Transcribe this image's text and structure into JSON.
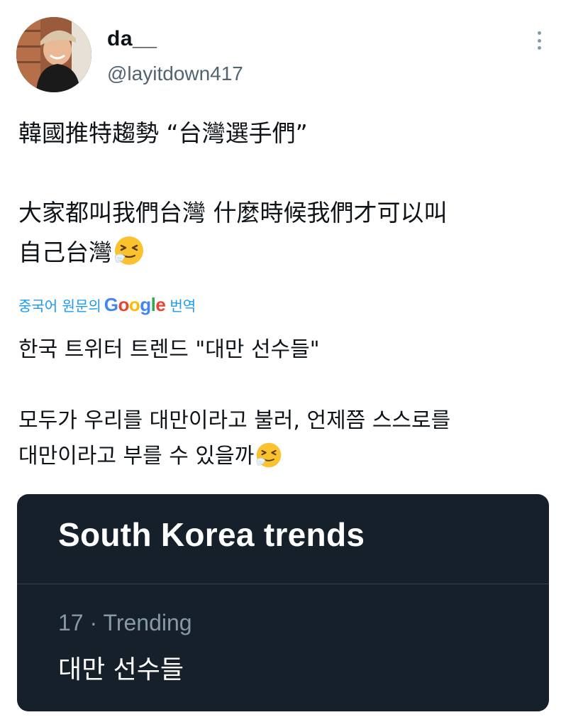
{
  "user": {
    "display_name": "da__",
    "handle": "@layitdown417"
  },
  "tweet": {
    "line1": "韓國推特趨勢 “台灣選手們”",
    "line2": "大家都叫我們台灣 什麼時候我們才可以叫",
    "line3": "自己台灣",
    "emoji": "sneezing-face-emoji"
  },
  "translation": {
    "prefix": "중국어 원문의",
    "google": [
      "G",
      "o",
      "o",
      "g",
      "l",
      "e"
    ],
    "suffix": "번역",
    "line1": "한국 트위터 트렌드 \"대만 선수들\"",
    "line2": " 모두가 우리를 대만이라고 불러, 언제쯤 스스로를",
    "line3": "대만이라고 부를 수 있을까"
  },
  "trend_card": {
    "title": "South Korea trends",
    "meta": "17 · Trending",
    "trend": "대만 선수들"
  },
  "colors": {
    "link_blue": "#1d9bf0",
    "card_bg": "#15202b",
    "secondary_text": "#536471"
  }
}
